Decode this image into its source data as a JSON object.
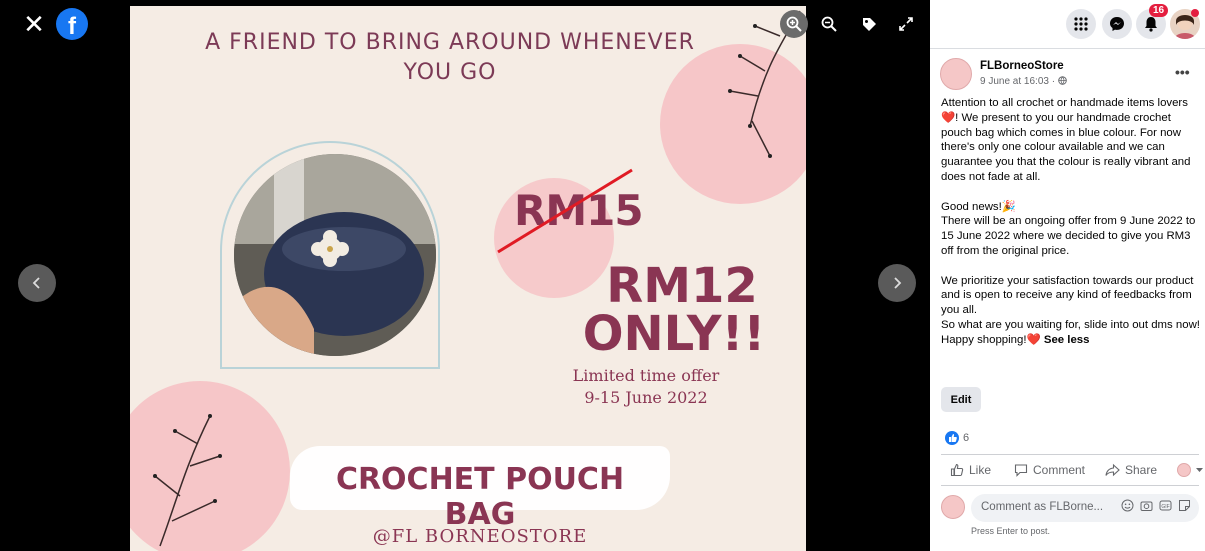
{
  "viewer": {
    "image": {
      "headline": "A FRIEND TO BRING AROUND WHENEVER YOU GO",
      "old_price": "RM15",
      "new_price": "RM12",
      "only_text": "ONLY!!",
      "offer_line1": "Limited time offer",
      "offer_line2": "9-15 June 2022",
      "product_name": "CROCHET POUCH BAG",
      "handle": "@FL BORNEOSTORE"
    },
    "icons": [
      "close-icon",
      "facebook-logo-icon",
      "zoom-in-icon",
      "zoom-out-icon",
      "tag-icon",
      "fullscreen-icon",
      "chevron-left-icon",
      "chevron-right-icon"
    ]
  },
  "header": {
    "notification_count": "16"
  },
  "post": {
    "page_name": "FLBorneoStore",
    "time": "9 June at 16:03 ·",
    "body": [
      "Attention to all crochet or handmade items lovers❤️! We present to you our handmade crochet pouch bag which comes in blue colour. For now there's only one colour available and we can guarantee you that the colour is really vibrant and does not fade at all.",
      "",
      "Good news!🎉",
      "There will be an ongoing offer from 9 June 2022 to 15 June 2022 where we decided to give you RM3 off from the original price.",
      "",
      "We prioritize your satisfaction towards our product and is open to receive any kind of feedbacks from you all.",
      "So what are you waiting for, slide into out dms now!"
    ],
    "closing": "Happy shopping!❤️",
    "see_less": "See less",
    "edit_label": "Edit",
    "like_count": "6",
    "actions": {
      "like": "Like",
      "comment": "Comment",
      "share": "Share"
    },
    "comment_placeholder": "Comment as FLBorne...",
    "comment_hint": "Press Enter to post."
  },
  "colors": {
    "brand": "#1877f2",
    "accent": "#8a3553",
    "badge": "#e41e3f"
  }
}
